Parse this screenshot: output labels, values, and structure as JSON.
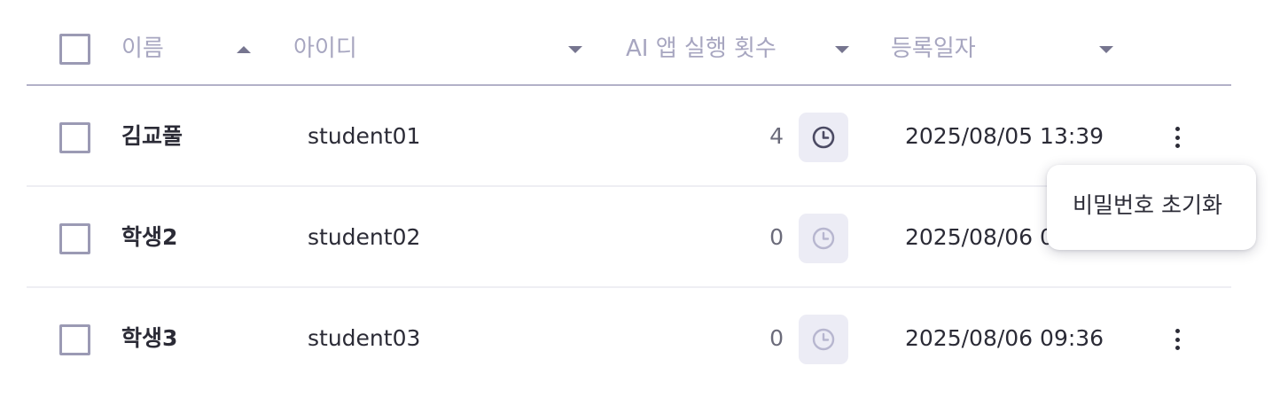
{
  "header": {
    "name_label": "이름",
    "id_label": "아이디",
    "count_label": "AI 앱 실행 횟수",
    "date_label": "등록일자"
  },
  "rows": [
    {
      "name": "김교풀",
      "id": "student01",
      "count": "4",
      "date": "2025/08/05 13:39",
      "clock_active": true
    },
    {
      "name": "학생2",
      "id": "student02",
      "count": "0",
      "date": "2025/08/06 09:36",
      "clock_active": false
    },
    {
      "name": "학생3",
      "id": "student03",
      "count": "0",
      "date": "2025/08/06 09:36",
      "clock_active": false
    }
  ],
  "menu": {
    "reset_password_label": "비밀번호 초기화"
  },
  "icons": {
    "header_checkbox": "checkbox-icon",
    "sort_asc": "sort-ascending-icon",
    "sort_desc": "sort-dropdown-icon",
    "history": "clock-icon",
    "more": "more-vertical-icon"
  },
  "colors": {
    "header_text": "#a7a6c0",
    "border": "#b3b1c8",
    "checkbox_border": "#9b9ab4",
    "clock_active": "#4b4a63",
    "clock_inactive": "#b7b6cf",
    "clock_bg": "#ececf5"
  }
}
